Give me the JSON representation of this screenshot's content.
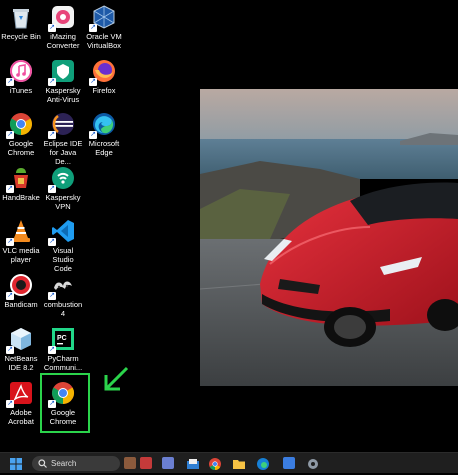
{
  "desktop_icons": [
    {
      "id": "recycle-bin",
      "label": "Recycle Bin"
    },
    {
      "id": "imazing-converter",
      "label": "iMazing Converter"
    },
    {
      "id": "oracle-vm-virtualbox",
      "label": "Oracle VM VirtualBox"
    },
    {
      "id": "itunes",
      "label": "iTunes"
    },
    {
      "id": "kaspersky-anti-virus",
      "label": "Kaspersky Anti-Virus"
    },
    {
      "id": "firefox",
      "label": "Firefox"
    },
    {
      "id": "google-chrome-1",
      "label": "Google Chrome"
    },
    {
      "id": "eclipse-ide",
      "label": "Eclipse IDE for Java De..."
    },
    {
      "id": "microsoft-edge",
      "label": "Microsoft Edge"
    },
    {
      "id": "handbrake",
      "label": "HandBrake"
    },
    {
      "id": "kaspersky-vpn",
      "label": "Kaspersky VPN"
    },
    {
      "id": "vlc-media-player",
      "label": "VLC media player"
    },
    {
      "id": "visual-studio-code",
      "label": "Visual Studio Code"
    },
    {
      "id": "bandicam",
      "label": "Bandicam"
    },
    {
      "id": "combustion-4",
      "label": "combustion 4"
    },
    {
      "id": "netbeans-ide",
      "label": "NetBeans IDE 8.2"
    },
    {
      "id": "pycharm",
      "label": "PyCharm Communi..."
    },
    {
      "id": "adobe-acrobat",
      "label": "Adobe Acrobat"
    },
    {
      "id": "google-chrome-2",
      "label": "Google Chrome"
    }
  ],
  "taskbar": {
    "search_label": "Search"
  },
  "colors": {
    "highlight_green": "#2bd44b",
    "taskbar_bg": "#1f1f1f"
  }
}
